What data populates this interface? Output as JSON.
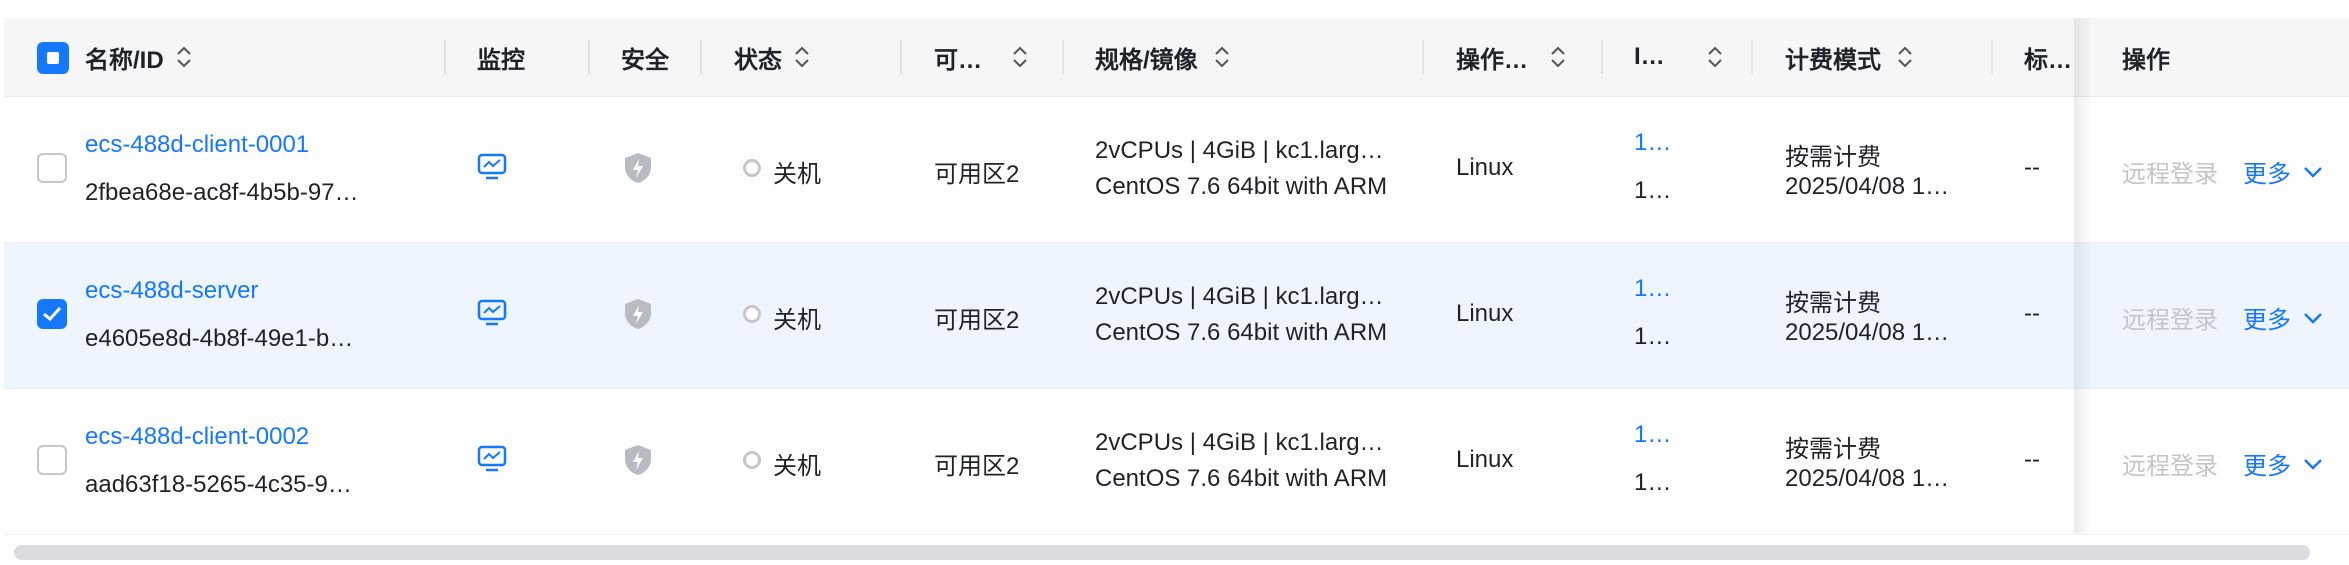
{
  "header": {
    "name_id": "名称/ID",
    "monitor": "监控",
    "security": "安全",
    "status": "状态",
    "zone": "可…",
    "spec": "规格/镜像",
    "os": "操作…",
    "ip": "I…",
    "billing": "计费模式",
    "tag": "标…",
    "actions": "操作"
  },
  "rows": [
    {
      "name": "ecs-488d-client-0001",
      "id": "2fbea68e-ac8f-4b5b-97…",
      "status": "关机",
      "zone": "可用区2",
      "spec_line1": "2vCPUs | 4GiB | kc1.larg…",
      "spec_line2": "CentOS 7.6 64bit with ARM",
      "os": "Linux",
      "ip_line1": "1…",
      "ip_line2": "1…",
      "billing_mode": "按需计费",
      "billing_time": "2025/04/08 1…",
      "tag": "--",
      "remote_login": "远程登录",
      "more": "更多",
      "selected": false
    },
    {
      "name": "ecs-488d-server",
      "id": "e4605e8d-4b8f-49e1-b…",
      "status": "关机",
      "zone": "可用区2",
      "spec_line1": "2vCPUs | 4GiB | kc1.larg…",
      "spec_line2": "CentOS 7.6 64bit with ARM",
      "os": "Linux",
      "ip_line1": "1…",
      "ip_line2": "1…",
      "billing_mode": "按需计费",
      "billing_time": "2025/04/08 1…",
      "tag": "--",
      "remote_login": "远程登录",
      "more": "更多",
      "selected": true
    },
    {
      "name": "ecs-488d-client-0002",
      "id": "aad63f18-5265-4c35-9…",
      "status": "关机",
      "zone": "可用区2",
      "spec_line1": "2vCPUs | 4GiB | kc1.larg…",
      "spec_line2": "CentOS 7.6 64bit with ARM",
      "os": "Linux",
      "ip_line1": "1…",
      "ip_line2": "1…",
      "billing_mode": "按需计费",
      "billing_time": "2025/04/08 1…",
      "tag": "--",
      "remote_login": "远程登录",
      "more": "更多",
      "selected": false
    }
  ],
  "icons": {
    "monitor": "monitor-icon",
    "security": "shield-bolt-icon",
    "sort": "sort-icon",
    "more": "chevron-down-icon"
  },
  "colors": {
    "accent": "#1677ff",
    "muted": "#c2c5cb",
    "selected_row": "#eef5ff",
    "header_bg": "#f5f6f7"
  }
}
